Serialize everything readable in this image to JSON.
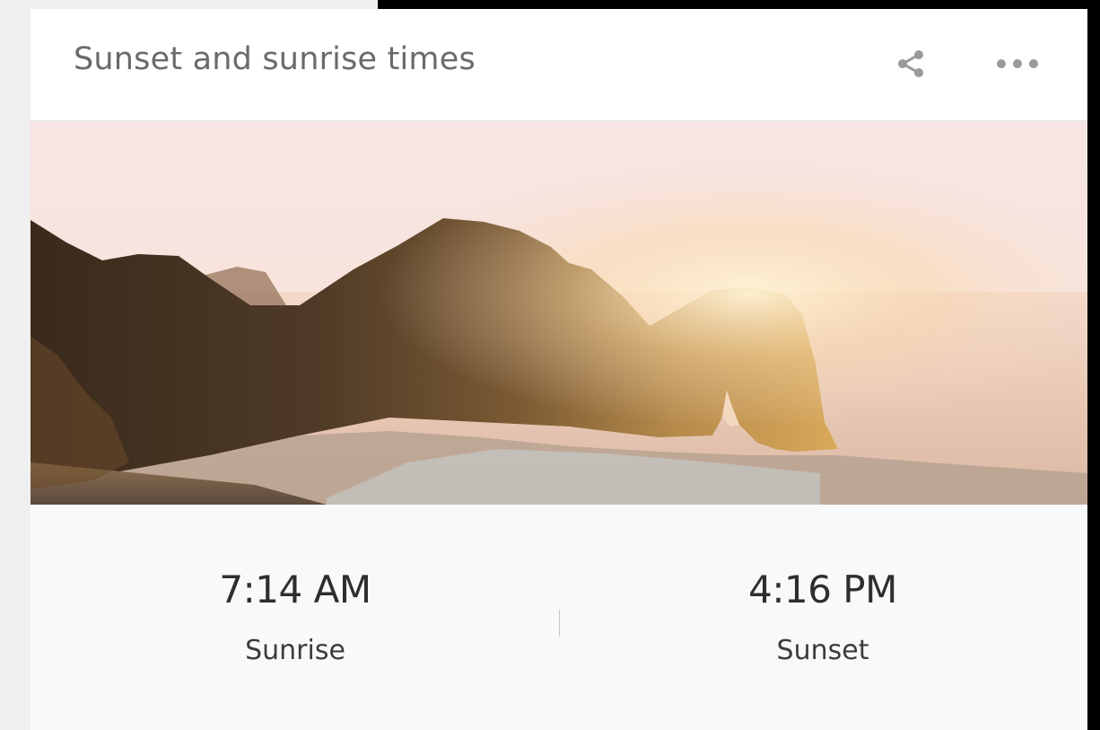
{
  "card": {
    "title": "Sunset and sunrise times",
    "share_icon": "share-icon",
    "more_icon": "more-options-icon"
  },
  "hero": {
    "image": "coastal-rock-arch-at-sunset"
  },
  "times": {
    "sunrise": {
      "time": "7:14 AM",
      "label": "Sunrise"
    },
    "sunset": {
      "time": "4:16 PM",
      "label": "Sunset"
    }
  },
  "colors": {
    "title_text": "#6a6a6a",
    "time_text": "#2e2e2e",
    "label_text": "#3c3c3c",
    "icon": "#9a9a9a"
  }
}
